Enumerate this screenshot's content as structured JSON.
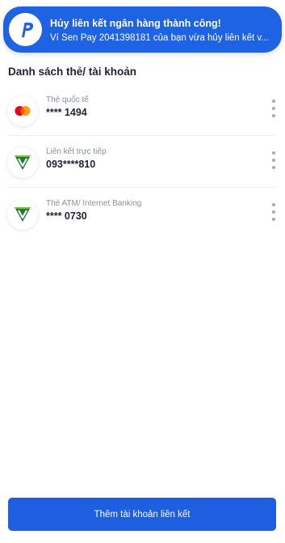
{
  "toast": {
    "title": "Hủy liên kết ngân hàng thành công!",
    "body": "Ví Sen Pay 2041398181 của bạn vừa hủy liên kết v...",
    "logo_icon": "p-logo-icon"
  },
  "section_title": "Danh sách thẻ/ tài khoản",
  "cards": [
    {
      "icon": "mastercard-icon",
      "label": "Thẻ quốc tế",
      "number": "**** 1494"
    },
    {
      "icon": "vietcombank-icon",
      "label": "Liên kết trực tiếp",
      "number": "093****810"
    },
    {
      "icon": "vietcombank-icon",
      "label": "Thẻ ATM/ Internet Banking",
      "number": "**** 0730"
    }
  ],
  "add_button_label": "Thêm tài khoản liên kết",
  "colors": {
    "primary": "#1d5fe0",
    "text": "#1d2433",
    "muted": "#8a8f99",
    "vcb_green": "#1e7a35"
  }
}
